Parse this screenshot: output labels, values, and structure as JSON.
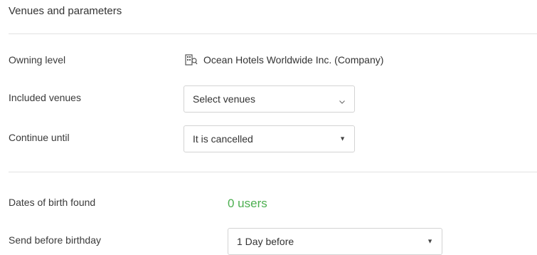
{
  "section": {
    "title": "Venues and parameters"
  },
  "owning_level": {
    "label": "Owning level",
    "value": "Ocean Hotels Worldwide Inc. (Company)",
    "icon": "company-building-icon"
  },
  "included_venues": {
    "label": "Included venues",
    "value": "Select venues",
    "icon": "chevron-down-icon"
  },
  "continue_until": {
    "label": "Continue until",
    "value": "It is cancelled",
    "icon": "caret-down-icon"
  },
  "dates_of_birth": {
    "label": "Dates of birth found",
    "value": "0 users",
    "color": "#4caf50"
  },
  "send_before": {
    "label": "Send before birthday",
    "value": "1 Day before",
    "icon": "caret-down-icon"
  }
}
